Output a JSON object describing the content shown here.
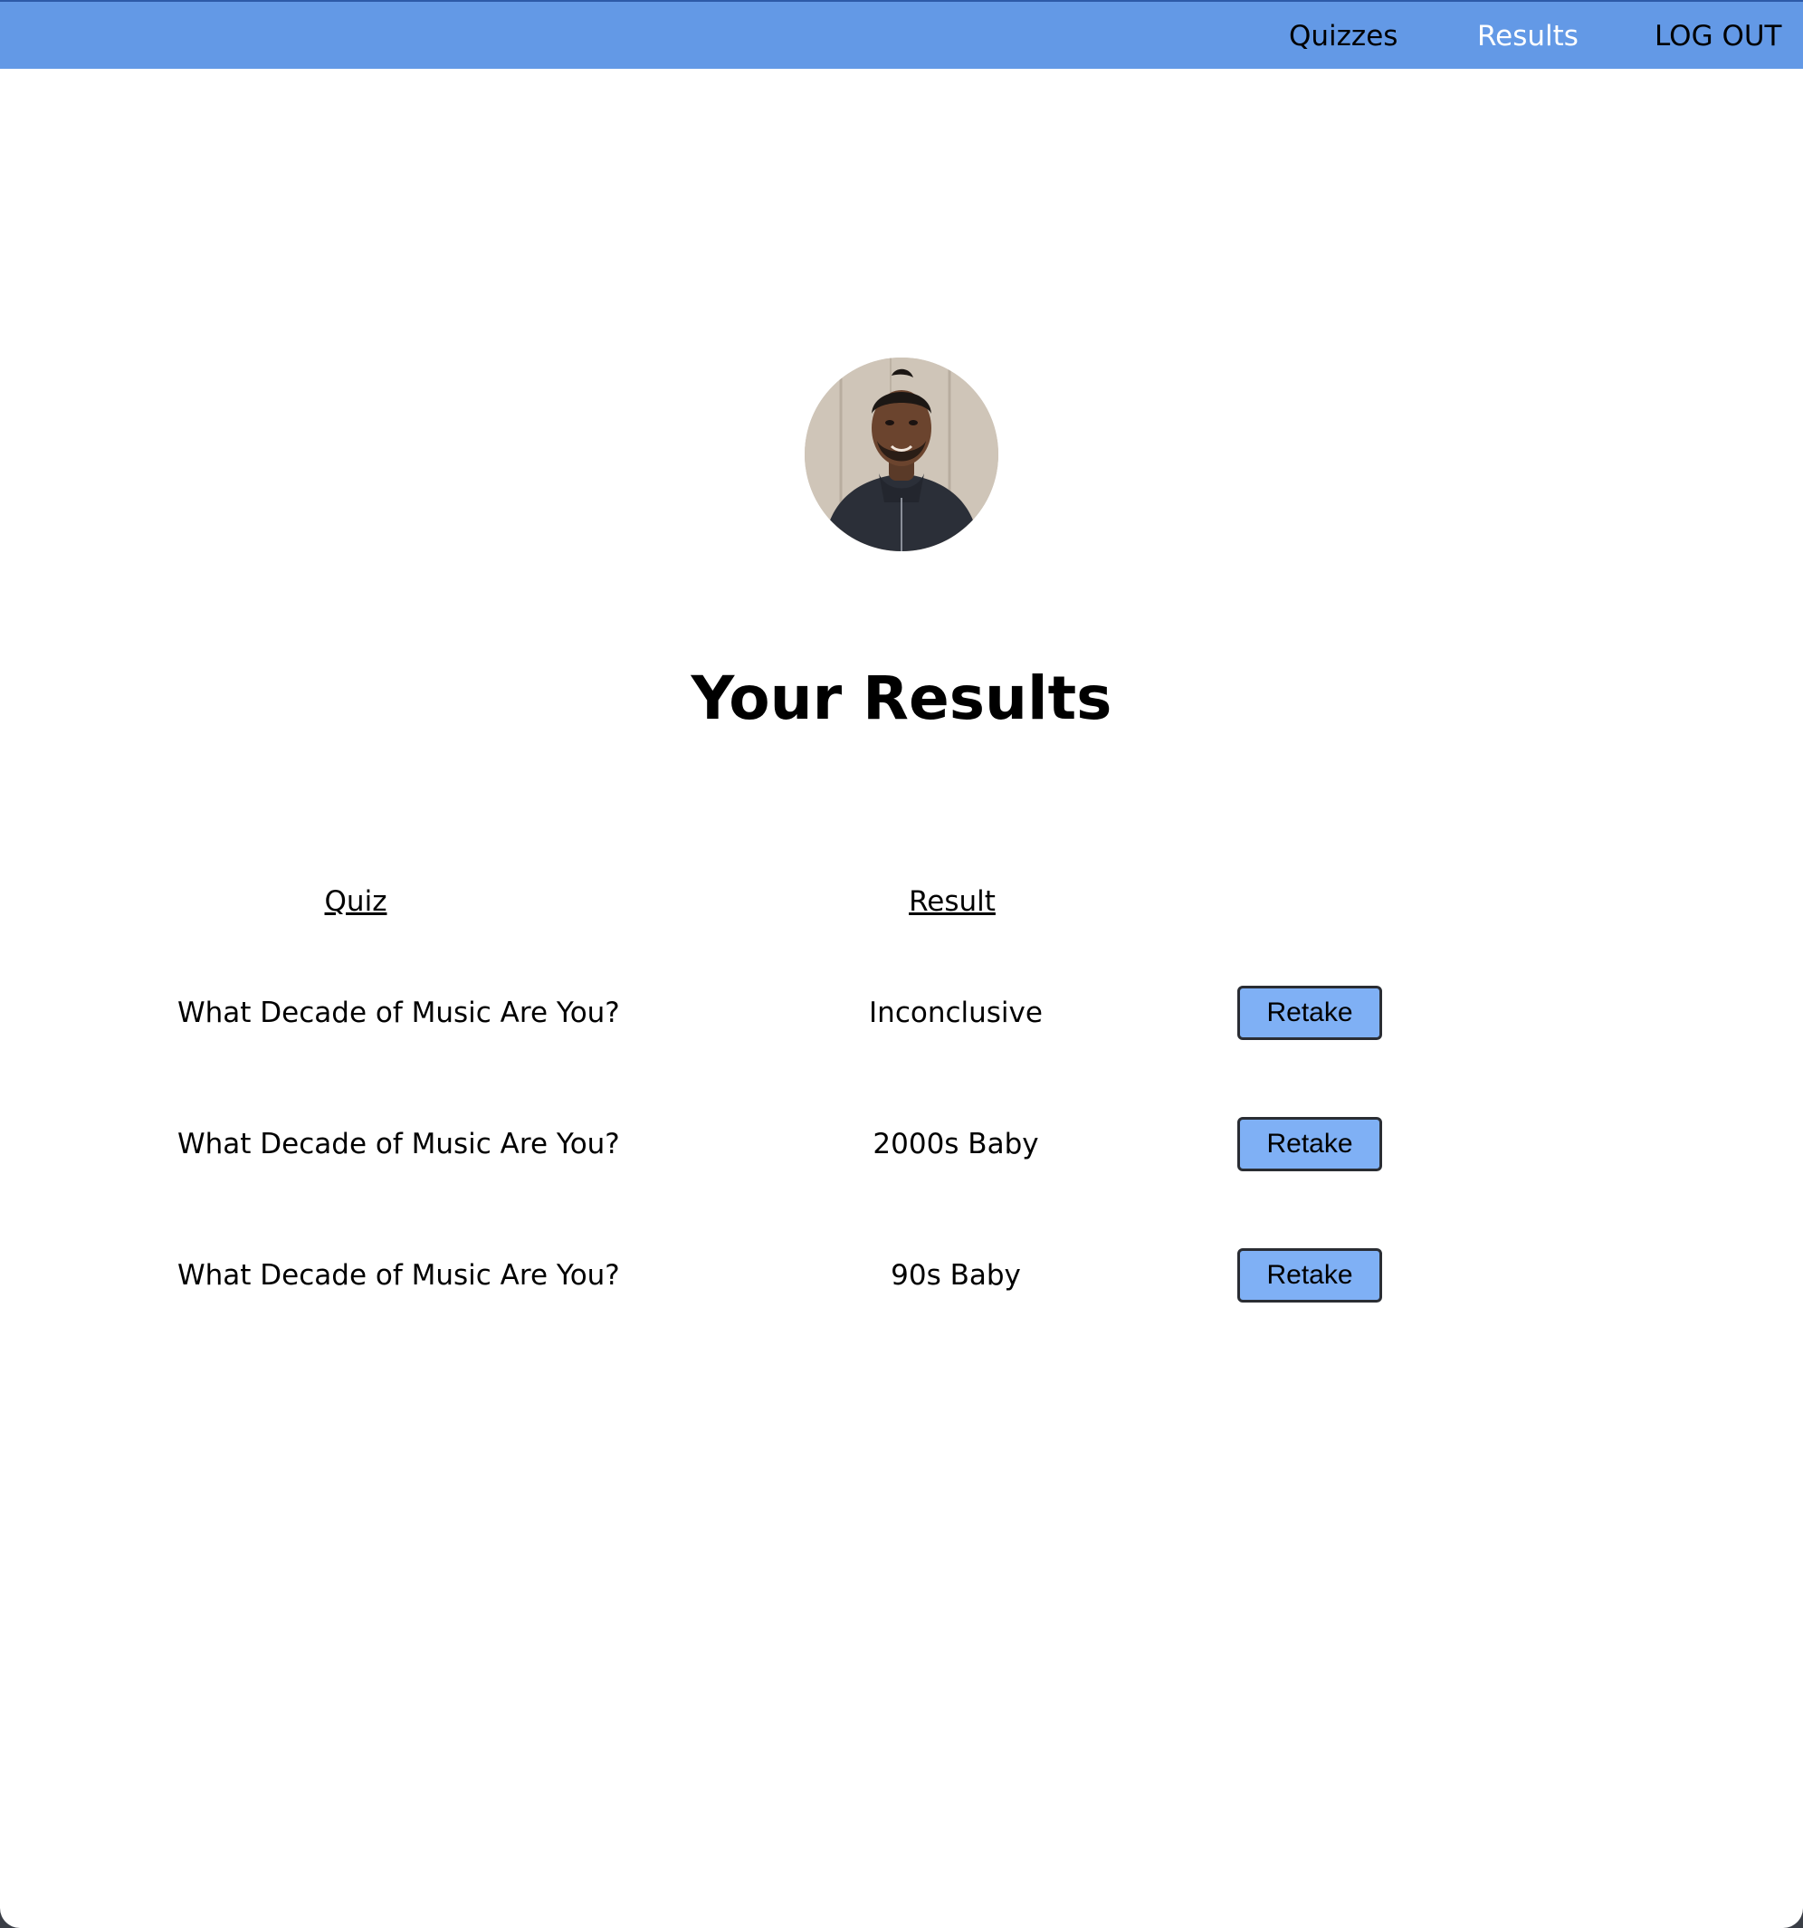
{
  "nav": {
    "quizzes_label": "Quizzes",
    "results_label": "Results",
    "logout_label": "LOG OUT",
    "bar_color": "#6399e6",
    "active_color": "#ffffff"
  },
  "profile": {
    "avatar_icon": "user-photo"
  },
  "page": {
    "title": "Your Results"
  },
  "table": {
    "headers": {
      "quiz": "Quiz",
      "result": "Result"
    },
    "rows": [
      {
        "quiz": "What Decade of Music Are You?",
        "result": "Inconclusive",
        "action": "Retake"
      },
      {
        "quiz": "What Decade of Music Are You?",
        "result": "2000s Baby",
        "action": "Retake"
      },
      {
        "quiz": "What Decade of Music Are You?",
        "result": "90s Baby",
        "action": "Retake"
      }
    ]
  },
  "colors": {
    "button_bg": "#7fb0f5",
    "button_border": "#2a2d33"
  }
}
